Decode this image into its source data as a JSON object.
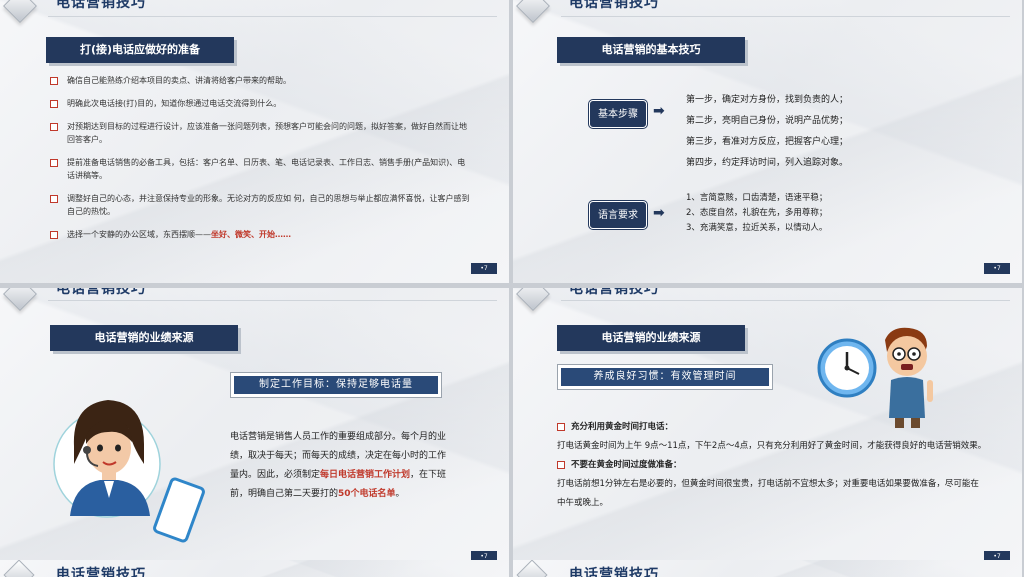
{
  "header_title": "电话营销技巧",
  "page_label": "•7",
  "slide1": {
    "tag": "打(接)电话应做好的准备",
    "bullets": [
      "确信自己能熟练介绍本项目的卖点、讲清将给客户带来的帮助。",
      "明确此次电话接(打)目的，知道你想通过电话交流得到什么。",
      "对预期达到目标的过程进行设计，应该准备一张问题列表，预想客户可能会问的问题，拟好答案，做好自然而让地回答客户。",
      "提前准备电话销售的必备工具，包括：客户名单、日历表、笔、电话记录表、工作日志、销售手册(产品知识)、电话讲稿等。",
      "调整好自己的心态，并注意保持专业的形象。无论对方的反应如  何，自己的思想与举止都应满怀喜悦，让客户感到自己的热忱。"
    ],
    "last_bullet_prefix": "选择一个安静的办公区域，东西摆顺——",
    "last_bullet_red": "坐好、微笑、开始……"
  },
  "slide2": {
    "tag": "电话营销的基本技巧",
    "pill1": "基本步骤",
    "steps1": [
      "第一步，确定对方身份，找到负责的人；",
      "第二步，亮明自己身份，说明产品优势；",
      "第三步，看准对方反应，把握客户心理；",
      "第四步，约定拜访时间，列入追踪对象。"
    ],
    "pill2": "语言要求",
    "steps2": [
      "1、言简意赅，口齿清楚，语速平稳；",
      "2、态度自然，礼貌在先，多用尊称；",
      "3、充满笑意，拉近关系，以情动人。"
    ]
  },
  "slide3": {
    "tag": "电话营销的业绩来源",
    "banner": "制定工作目标：保持足够电话量",
    "p1": "电话营销是销售人员工作的重要组成部分。每个月的业绩，取决于每天；而每天的成绩，决定在每小时的工作量内。因此，必须制定",
    "p1_red": "每日电话营销工作计划",
    "p2": "，在下班前，明确自己第二天要打的",
    "p2_red": "50个电话名单",
    "p3": "。"
  },
  "slide4": {
    "tag": "电话营销的业绩来源",
    "banner": "养成良好习惯：有效管理时间",
    "h1": "充分利用黄金时间打电话：",
    "t1": "打电话黄金时间为上午 9点～11点，下午2点～4点，只有充分利用好了黄金时间，才能获得良好的电话营销效果。",
    "h2": "不要在黄金时间过度做准备：",
    "t2": "打电话前想1分钟左右是必要的，但黄金时间很宝贵，打电话前不宜想太多；对重要电话如果要做准备，尽可能在中午或晚上。"
  },
  "colors": {
    "navy": "#23385c",
    "accent_red": "#c0392b",
    "title": "#1e3a66"
  }
}
